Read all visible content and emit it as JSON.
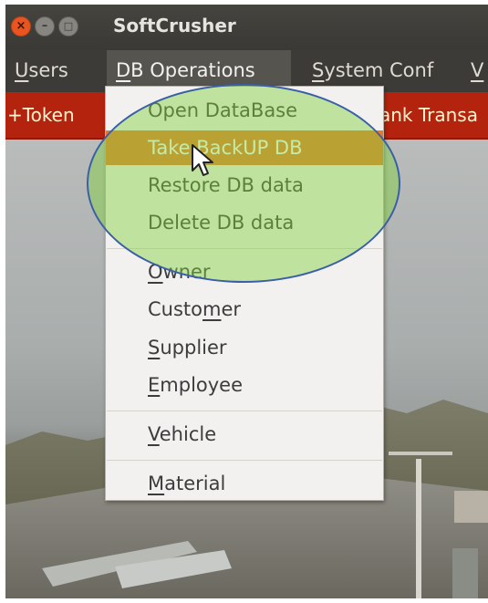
{
  "window": {
    "title": "SoftCrusher"
  },
  "menubar": {
    "users_pre": "",
    "users_mnem": "U",
    "users_post": "sers",
    "db_pre": "",
    "db_mnem": "D",
    "db_post": "B Operations",
    "sys_pre": "",
    "sys_mnem": "S",
    "sys_post": "ystem Conf",
    "more_pre": "",
    "more_mnem": "V",
    "more_post": ""
  },
  "toolbar": {
    "token": "+Token",
    "bank": "ank Transa"
  },
  "db_menu": {
    "open_db": "Open DataBase",
    "backup_db": "Take BackUP DB",
    "restore_db": "Restore DB data",
    "delete_db": "Delete DB data",
    "owner_pre": "",
    "owner_mnem": "O",
    "owner_post": "wner",
    "customer_pre": "Custo",
    "customer_mnem": "m",
    "customer_post": "er",
    "supplier_pre": "",
    "supplier_mnem": "S",
    "supplier_post": "upplier",
    "employee_pre": "",
    "employee_mnem": "E",
    "employee_post": "mployee",
    "vehicle_pre": "",
    "vehicle_mnem": "V",
    "vehicle_post": "ehicle",
    "material_pre": "",
    "material_mnem": "M",
    "material_post": "aterial"
  },
  "icons": {
    "close": "close-icon",
    "minimize": "minimize-icon",
    "maximize": "maximize-icon",
    "cursor": "mouse-pointer-icon"
  },
  "colors": {
    "toolbar_bg": "#b4230d",
    "highlight": "#e9782c",
    "annotation": "#80d23c",
    "annotation_border": "#3b5fa6"
  }
}
